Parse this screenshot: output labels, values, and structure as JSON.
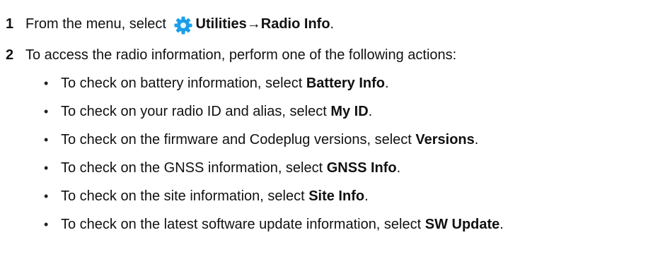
{
  "steps": [
    {
      "number": "1",
      "text_before": "From the menu, select",
      "icon": "gear-icon",
      "bold_text": "Utilities→Radio Info",
      "text_after": "."
    },
    {
      "number": "2",
      "text": "To access the radio information, perform one of the following actions:"
    }
  ],
  "bullets": [
    {
      "prefix": "To check on battery information, select",
      "bold": "Battery Info",
      "suffix": "."
    },
    {
      "prefix": "To check on your radio ID and alias, select",
      "bold": "My ID",
      "suffix": "."
    },
    {
      "prefix": "To check on the firmware and Codeplug versions, select",
      "bold": "Versions",
      "suffix": "."
    },
    {
      "prefix": "To check on the GNSS information, select",
      "bold": "GNSS Info",
      "suffix": "."
    },
    {
      "prefix": "To check on the site information, select",
      "bold": "Site Info",
      "suffix": "."
    },
    {
      "prefix": "To check on the latest software update information, select",
      "bold": "SW Update",
      "suffix": "."
    }
  ],
  "bullet_symbol": "•",
  "colors": {
    "gear_icon": "#1a9fe8",
    "text": "#111111"
  }
}
